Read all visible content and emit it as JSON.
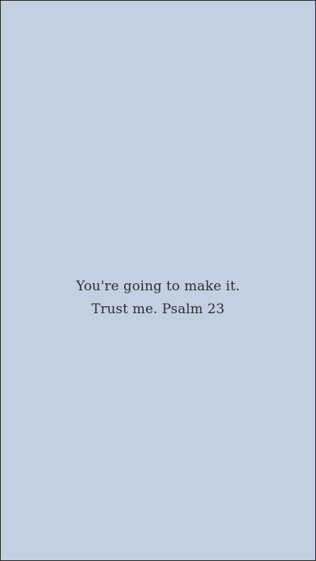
{
  "background": {
    "color": "#c3d0e1"
  },
  "quote": {
    "line1": "You're going to make it.",
    "line2": "Trust me. Psalm 23",
    "color": "#2c2f36"
  }
}
